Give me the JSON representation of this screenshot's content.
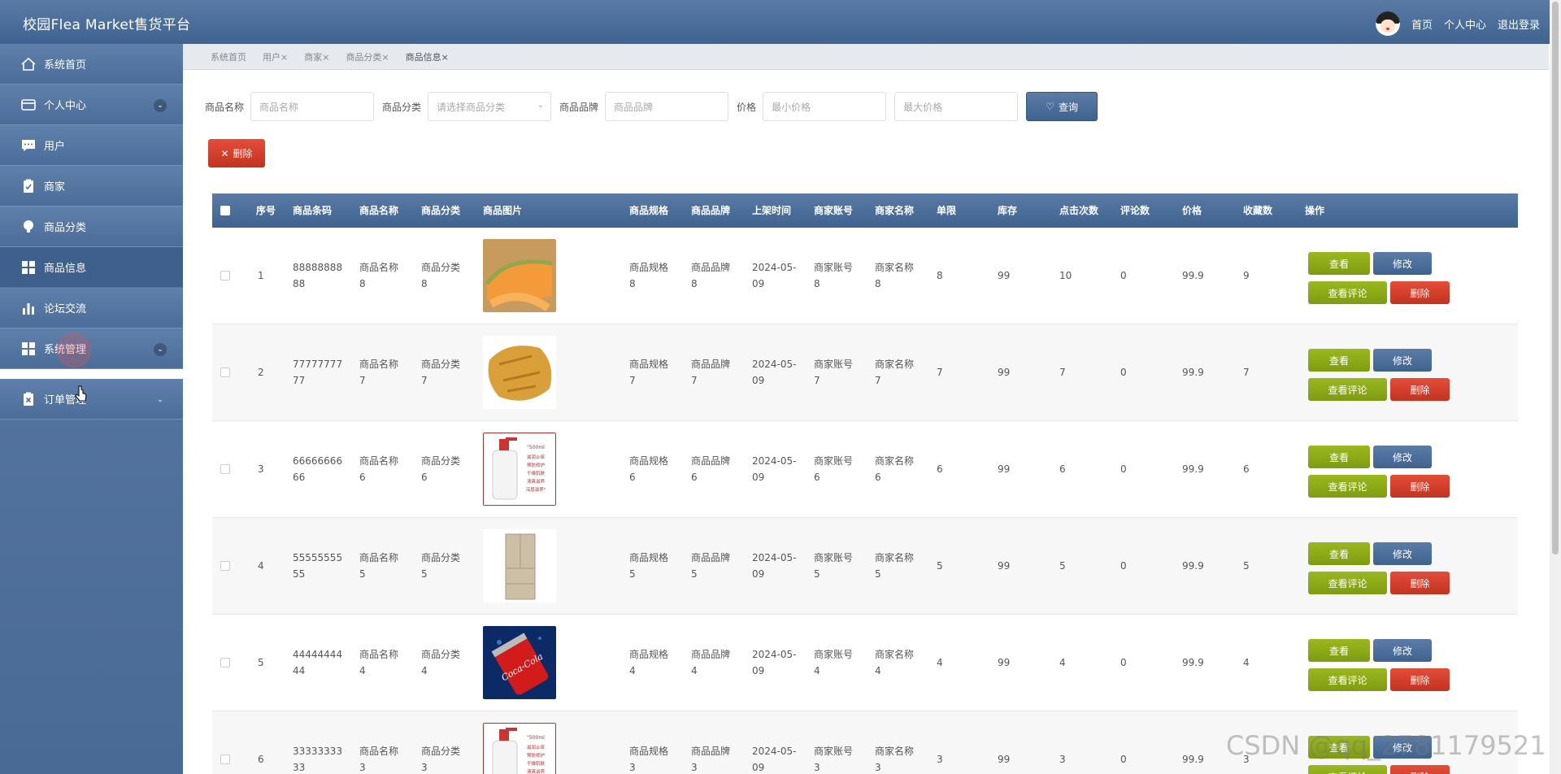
{
  "header": {
    "app_title": "校园Flea Market售货平台",
    "links": [
      "首页",
      "个人中心",
      "退出登录"
    ]
  },
  "sidebar": {
    "items": [
      {
        "label": "系统首页",
        "icon": "home-icon"
      },
      {
        "label": "个人中心",
        "icon": "card-icon",
        "expandable": true
      },
      {
        "label": "用户",
        "icon": "chat-icon"
      },
      {
        "label": "商家",
        "icon": "clipboard-check-icon"
      },
      {
        "label": "商品分类",
        "icon": "bulb-icon"
      },
      {
        "label": "商品信息",
        "icon": "grid-icon",
        "active": true
      },
      {
        "label": "论坛交流",
        "icon": "bar-chart-icon"
      },
      {
        "label": "系统管理",
        "icon": "grid-icon",
        "expandable": true
      },
      {
        "label": "订单管理",
        "icon": "clipboard-x-icon",
        "expandable": true
      }
    ]
  },
  "tabs": [
    "系统首页",
    "用户×",
    "商家×",
    "商品分类×",
    "商品信息×"
  ],
  "search": {
    "name_label": "商品名称",
    "name_placeholder": "商品名称",
    "category_label": "商品分类",
    "category_placeholder": "请选择商品分类",
    "brand_label": "商品品牌",
    "brand_placeholder": "商品品牌",
    "price_label": "价格",
    "min_price_placeholder": "最小价格",
    "max_price_placeholder": "最大价格",
    "query_label": "查询"
  },
  "delete_all_label": "删除",
  "table": {
    "headers": [
      "序号",
      "商品条码",
      "商品名称",
      "商品分类",
      "商品图片",
      "商品规格",
      "商品品牌",
      "上架时间",
      "商家账号",
      "商家名称",
      "单限",
      "库存",
      "点击次数",
      "评论数",
      "价格",
      "收藏数",
      "操作"
    ],
    "buttons": {
      "view": "查看",
      "edit": "修改",
      "review": "查看评论",
      "delete": "删除"
    },
    "rows": [
      {
        "no": "1",
        "code": [
          "88888888",
          "88"
        ],
        "name": [
          "商品名称",
          "8"
        ],
        "category": [
          "商品分类",
          "8"
        ],
        "image": "melon",
        "spec": [
          "商品规格",
          "8"
        ],
        "brand": [
          "商品品牌",
          "8"
        ],
        "date": [
          "2024-05-",
          "09"
        ],
        "account": [
          "商家账号",
          "8"
        ],
        "merchant": [
          "商家名称",
          "8"
        ],
        "limit": "8",
        "stock": "99",
        "clicks": "10",
        "reviews": "0",
        "price": "99.9",
        "favorites": "9"
      },
      {
        "no": "2",
        "code": [
          "77777777",
          "77"
        ],
        "name": [
          "商品名称",
          "7"
        ],
        "category": [
          "商品分类",
          "7"
        ],
        "image": "crisp",
        "spec": [
          "商品规格",
          "7"
        ],
        "brand": [
          "商品品牌",
          "7"
        ],
        "date": [
          "2024-05-",
          "09"
        ],
        "account": [
          "商家账号",
          "7"
        ],
        "merchant": [
          "商家名称",
          "7"
        ],
        "limit": "7",
        "stock": "99",
        "clicks": "7",
        "reviews": "0",
        "price": "99.9",
        "favorites": "7"
      },
      {
        "no": "3",
        "code": [
          "66666666",
          "66"
        ],
        "name": [
          "商品名称",
          "6"
        ],
        "category": [
          "商品分类",
          "6"
        ],
        "image": "lotion",
        "spec": [
          "商品规格",
          "6"
        ],
        "brand": [
          "商品品牌",
          "6"
        ],
        "date": [
          "2024-05-",
          "09"
        ],
        "account": [
          "商家账号",
          "6"
        ],
        "merchant": [
          "商家名称",
          "6"
        ],
        "limit": "6",
        "stock": "99",
        "clicks": "6",
        "reviews": "0",
        "price": "99.9",
        "favorites": "6"
      },
      {
        "no": "4",
        "code": [
          "55555555",
          "55"
        ],
        "name": [
          "商品名称",
          "5"
        ],
        "category": [
          "商品分类",
          "5"
        ],
        "image": "fridge",
        "spec": [
          "商品规格",
          "5"
        ],
        "brand": [
          "商品品牌",
          "5"
        ],
        "date": [
          "2024-05-",
          "09"
        ],
        "account": [
          "商家账号",
          "5"
        ],
        "merchant": [
          "商家名称",
          "5"
        ],
        "limit": "5",
        "stock": "99",
        "clicks": "5",
        "reviews": "0",
        "price": "99.9",
        "favorites": "5"
      },
      {
        "no": "5",
        "code": [
          "44444444",
          "44"
        ],
        "name": [
          "商品名称",
          "4"
        ],
        "category": [
          "商品分类",
          "4"
        ],
        "image": "cola",
        "spec": [
          "商品规格",
          "4"
        ],
        "brand": [
          "商品品牌",
          "4"
        ],
        "date": [
          "2024-05-",
          "09"
        ],
        "account": [
          "商家账号",
          "4"
        ],
        "merchant": [
          "商家名称",
          "4"
        ],
        "limit": "4",
        "stock": "99",
        "clicks": "4",
        "reviews": "0",
        "price": "99.9",
        "favorites": "4"
      },
      {
        "no": "6",
        "code": [
          "33333333",
          "33"
        ],
        "name": [
          "商品名称",
          "3"
        ],
        "category": [
          "商品分类",
          "3"
        ],
        "image": "lotion",
        "spec": [
          "商品规格",
          "3"
        ],
        "brand": [
          "商品品牌",
          "3"
        ],
        "date": [
          "2024-05-",
          "09"
        ],
        "account": [
          "商家账号",
          "3"
        ],
        "merchant": [
          "商家名称",
          "3"
        ],
        "limit": "3",
        "stock": "99",
        "clicks": "3",
        "reviews": "0",
        "price": "99.9",
        "favorites": "3"
      }
    ]
  },
  "image_caption": "\"500ml 滋润止痒 预防修护 干燥肌肤 清爽滋养 深层滋养\"",
  "cola_brand": "Coca-Cola",
  "watermark": "CSDN @qq_2781179521"
}
